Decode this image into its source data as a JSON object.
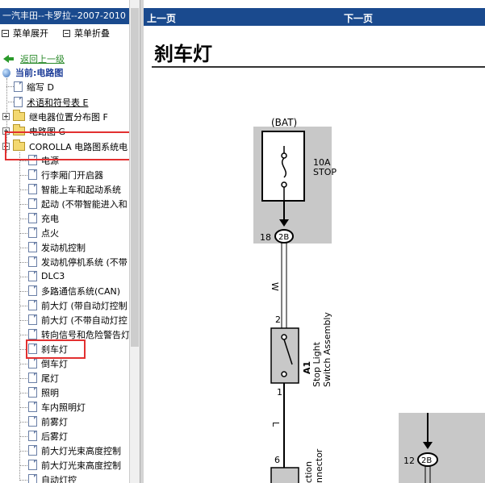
{
  "sidebar": {
    "title": "一汽丰田--卡罗拉--2007-2010",
    "expand_all": "菜单展开",
    "collapse_all": "菜单折叠",
    "back": "返回上一级",
    "current": "当前:电路图",
    "items": [
      {
        "label": "缩写 D",
        "icon": "document-icon"
      },
      {
        "label": "术语和符号表 E",
        "icon": "document-icon"
      },
      {
        "label": "继电器位置分布图 F",
        "icon": "folder-icon"
      },
      {
        "label": "电路图 G",
        "icon": "folder-icon"
      },
      {
        "label": "COROLLA 电路图系统电",
        "icon": "folder-icon"
      }
    ],
    "subitems": [
      "电源",
      "行李厢门开启器",
      "智能上车和起动系统",
      "起动 (不带智能进入和",
      "充电",
      "点火",
      "发动机控制",
      "发动机停机系统 (不带",
      "DLC3",
      "多路通信系统(CAN)",
      "前大灯 (带自动灯控制",
      "前大灯 (不带自动灯控",
      "转向信号和危险警告灯",
      "刹车灯",
      "倒车灯",
      "尾灯",
      "照明",
      "车内照明灯",
      "前雾灯",
      "后雾灯",
      "前大灯光束高度控制",
      "前大灯光束高度控制",
      "自动灯控"
    ]
  },
  "nav": {
    "prev": "上一页",
    "next": "下一页"
  },
  "page": {
    "title": "刹车灯"
  },
  "diagram": {
    "bat_label": "(BAT)",
    "fuse_rating": "10A",
    "fuse_name": "STOP",
    "connector_top_pin": "18",
    "connector_top_id": "2B",
    "wire_color_top": "W",
    "switch_pin_top": "2",
    "switch_id": "A1",
    "switch_name_1": "Stop Light",
    "switch_name_2": "Switch Assembly",
    "switch_pin_bottom": "1",
    "wire_color_bottom": "L",
    "lower_pin": "6",
    "lower_label_1": "ction",
    "lower_label_2": "nnector",
    "connector_right_pin": "12",
    "connector_right_id": "2B"
  },
  "colors": {
    "title_bar": "#1a4a8e",
    "highlight": "#e23030",
    "diagram_shade": "#c8c8c8"
  }
}
